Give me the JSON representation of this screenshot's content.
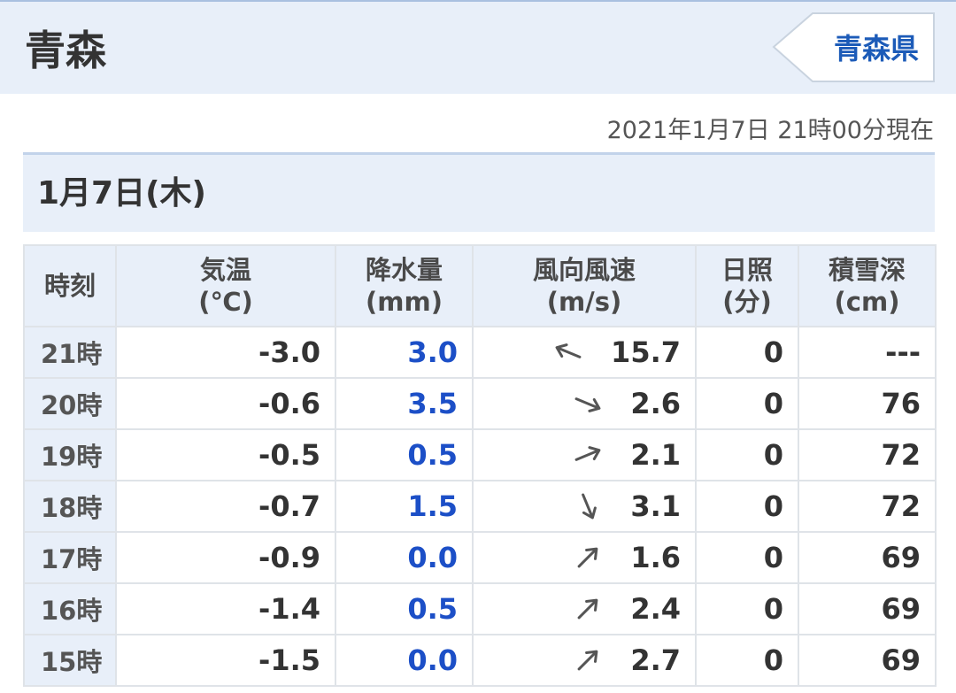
{
  "header": {
    "station": "青森",
    "prefecture_link": "青森県"
  },
  "timestamp": "2021年1月7日 21時00分現在",
  "date_label": "1月7日(木)",
  "table": {
    "columns": [
      {
        "key": "time",
        "line1": "時刻",
        "line2": ""
      },
      {
        "key": "temp",
        "line1": "気温",
        "line2": "(℃)"
      },
      {
        "key": "precip",
        "line1": "降水量",
        "line2": "(mm)"
      },
      {
        "key": "wind",
        "line1": "風向風速",
        "line2": "(m/s)"
      },
      {
        "key": "sun",
        "line1": "日照",
        "line2": "(分)"
      },
      {
        "key": "snow",
        "line1": "積雪深",
        "line2": "(cm)"
      }
    ],
    "rows": [
      {
        "time": "21時",
        "temp": "-3.0",
        "precip": "3.0",
        "wind_dir": "ESE",
        "wind_speed": "15.7",
        "sun": "0",
        "snow": "---"
      },
      {
        "time": "20時",
        "temp": "-0.6",
        "precip": "3.5",
        "wind_dir": "WNW",
        "wind_speed": "2.6",
        "sun": "0",
        "snow": "76"
      },
      {
        "time": "19時",
        "temp": "-0.5",
        "precip": "0.5",
        "wind_dir": "WSW",
        "wind_speed": "2.1",
        "sun": "0",
        "snow": "72"
      },
      {
        "time": "18時",
        "temp": "-0.7",
        "precip": "1.5",
        "wind_dir": "NNW",
        "wind_speed": "3.1",
        "sun": "0",
        "snow": "72"
      },
      {
        "time": "17時",
        "temp": "-0.9",
        "precip": "0.0",
        "wind_dir": "SW",
        "wind_speed": "1.6",
        "sun": "0",
        "snow": "69"
      },
      {
        "time": "16時",
        "temp": "-1.4",
        "precip": "0.5",
        "wind_dir": "SW",
        "wind_speed": "2.4",
        "sun": "0",
        "snow": "69"
      },
      {
        "time": "15時",
        "temp": "-1.5",
        "precip": "0.0",
        "wind_dir": "SW",
        "wind_speed": "2.7",
        "sun": "0",
        "snow": "69"
      }
    ]
  },
  "colors": {
    "accent_blue": "#1c5bb8",
    "precip_blue": "#1c4fc7",
    "header_bg": "#e8eff9",
    "grid": "#dfe3e8"
  }
}
